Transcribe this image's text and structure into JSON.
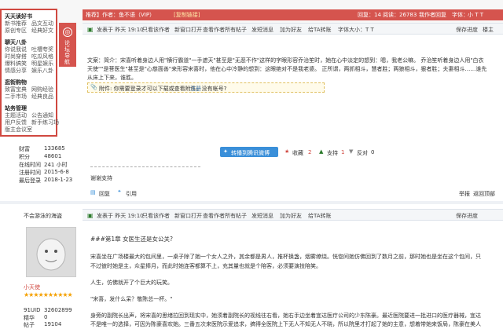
{
  "topbar": {
    "title_text": "推荐】作者：鱼不语（VIP）",
    "copy_link": "[复制链接]",
    "views_label": "回复：14",
    "reads_label": "阅读：26783",
    "author_label": "我作者回复",
    "font_label": "字体：",
    "font_sizes": "小 T T"
  },
  "menu": {
    "h1": "天天读好书",
    "items1": [
      "新书推荐",
      "品文互动",
      "原创专区",
      "经典好文"
    ],
    "h2": "聊天八卦",
    "items2": [
      "你说我说",
      "吐槽夸奖",
      "时尚穿搭",
      "吃瓜风格",
      "爆料搞笑",
      "明星娱乐",
      "情感分享",
      "娱乐八卦"
    ],
    "h3": "逛街购物",
    "items3": [
      "致富宝典",
      "网购经验",
      "二手市场",
      "经典良品"
    ],
    "h4": "站务管理",
    "items4": [
      "主题活动",
      "公告通知",
      "用户反馈",
      "新手练习场",
      "版主会议室"
    ],
    "tab_text": "论坛导航"
  },
  "post1": {
    "posted": "发表于 昨天 19:10",
    "view_author": "只看该作者",
    "new_post": "新窗口打开",
    "all_by": "查看作者所有帖子",
    "send_msg": "发短消息",
    "add_friend": "加为好友",
    "ta": "给TA转账",
    "font_size": "字体大小：T T",
    "save_progress": "保存进度",
    "floor": "楼主",
    "body_1": "文案：简介：宋喜听着身边人用\"横行霸道\"一手遮天\"甚至是\"无恶不作\"这样的字眼形容乔治笙时，她在心中淡定的想到：嗯，我老公嘛。 乔治笙听着身边人用\"白衣",
    "body_2": "天使\"\"是菩医生\"甚至是\"心慈面善\"来形容宋喜时，他在心中冷静的想到：这眼绝对不是我老婆。 正所谓，两抓相斗，慧者胜；两狼相斗，狠者胜；夫妻相斗……谁先",
    "body_3": "从床上下来，谁胜。",
    "attach_text": "附件: 你需要登录才可以下载或查看附件。没有帐号?",
    "attach_register": "注册",
    "share_btn": "转播到腾讯微博",
    "collect": "收藏",
    "collect_n": "2",
    "support": "支持",
    "support_n": "1",
    "against": "反对",
    "against_n": "0",
    "thanks_text": "谢谢支持",
    "reply_btn": "回复",
    "quote_btn": "引用",
    "report": "举报",
    "back_top": "返回顶部"
  },
  "stats1": [
    {
      "label": "财富",
      "value": "133685"
    },
    {
      "label": "积分",
      "value": "48601"
    },
    {
      "label": "在线时间",
      "value": "241 小时"
    },
    {
      "label": "注册时间",
      "value": "2015-6-8"
    },
    {
      "label": "最后登录",
      "value": "2018-1-23"
    }
  ],
  "user2": {
    "name": "不会游泳的海盗",
    "group": "小天使",
    "stats": [
      {
        "label": "91UID",
        "value": "32602899"
      },
      {
        "label": "精华",
        "value": "0"
      },
      {
        "label": "帖子",
        "value": "19104"
      }
    ]
  },
  "post2": {
    "posted": "发表于 昨天 19:10",
    "view_author": "只看该作者",
    "new_post": "新窗口打开",
    "all_by": "查看作者所有帖子",
    "send_msg": "发短消息",
    "add_friend": "加为好友",
    "ta": "给TA转账",
    "save_progress": "保存进度",
    "chapter": "###第1章 女医生还是女公关?",
    "p1": "宋喜坐在广场楼最大的包间里，一桌子除了她一个女人之外，其余都是男人，推杯换盏，烟雾缭绕。恍惚间她仿佛回到了数月之前，那时她也是坐在这个包间，只",
    "p2": "不过彼时她是主，众星捧月，而此时她连客都算不上，充其量也就是个陪客，必须要演技陪笑。",
    "p3": "人生，仿佛就开了个巨大的玩笑。",
    "p4": "\"宋喜，发什么呆？敬陈总一杯。\"",
    "p5": "身旁的副院长出声，将宋喜的思绪拉回到现实中，她须着副院长的视线往右看，她右手边坐着宜达医疗公司的少东陈豪。最近医院要进一批进口的医疗器械，宜达",
    "p6": "不是唯一的选择，可因为陈豪喜欢她。三番五次来医院示爱追求，搞得全医院上下无人不知无人不晓，所以院里才打起了她的主意，想着带她来饭局，陈豪在美人"
  }
}
